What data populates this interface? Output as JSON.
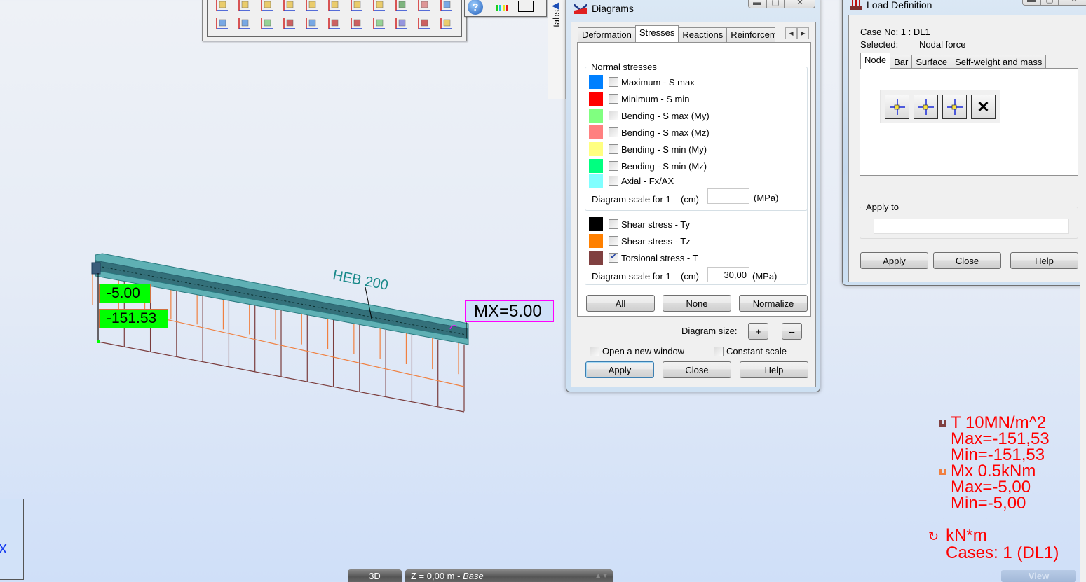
{
  "viewport": {
    "section_label": "HEB 200",
    "moment_label": "MX=5.00",
    "value_labels": [
      "-5.00",
      "-151.53"
    ],
    "corner_axis": "x",
    "colors": {
      "beam": "#4fa3a8",
      "torsion_diagram": "#7a3c3c",
      "moment_diagram": "#f08040",
      "value_label_bg": "#00ff00",
      "moment_label_border": "#ff00ff"
    }
  },
  "toolbar": {
    "row1_icons": [
      "view-xz-icon",
      "view-yz-icon",
      "view-xy-icon",
      "view-3d-icon",
      "axis-xz-icon",
      "axis-yz-icon",
      "axis-xy-icon",
      "structure-view-icon",
      "section-view-icon",
      "rotate-3d-icon",
      "rotate-x-icon"
    ],
    "row2_icons": [
      "rotate-y-icon",
      "rotate-z-icon",
      "zoom-window-icon",
      "zoom-previous-icon",
      "zoom-all-icon",
      "rotate-icon",
      "rotate-around-icon",
      "zoom-in-out-icon",
      "pan-icon",
      "render-icon",
      "windows-icon"
    ],
    "toolbar2_icons": [
      "help-icon",
      "legend-colors-icon",
      "table-icon"
    ]
  },
  "tabs_strip": {
    "label": "tabs"
  },
  "diagrams": {
    "title": "Diagrams",
    "tabs": [
      "Deformation",
      "Stresses",
      "Reactions",
      "Reinforcem"
    ],
    "active_tab": "Stresses",
    "normal_group_label": "Normal stresses",
    "normal_items": [
      {
        "label": "Maximum - S max",
        "color": "#0080ff",
        "checked": false
      },
      {
        "label": "Minimum - S min",
        "color": "#ff0000",
        "checked": false
      },
      {
        "label": "Bending - S max (My)",
        "color": "#80ff80",
        "checked": false
      },
      {
        "label": "Bending - S max (Mz)",
        "color": "#ff8080",
        "checked": false
      },
      {
        "label": "Bending - S min (My)",
        "color": "#ffff80",
        "checked": false
      },
      {
        "label": "Bending - S min (Mz)",
        "color": "#00ff80",
        "checked": false
      },
      {
        "label": "Axial - Fx/AX",
        "color": "#80ffff",
        "checked": false
      }
    ],
    "scale_label": "Diagram scale for 1",
    "scale_unit_cm": "(cm)",
    "scale_unit_mpa": "(MPa)",
    "normal_scale_value": "",
    "shear_items": [
      {
        "label": "Shear stress - Ty",
        "color": "#000000",
        "checked": false
      },
      {
        "label": "Shear stress - Tz",
        "color": "#ff8000",
        "checked": false
      },
      {
        "label": "Torsional stress - T",
        "color": "#804040",
        "checked": true
      }
    ],
    "shear_scale_value": "30,00",
    "btn_all": "All",
    "btn_none": "None",
    "btn_normalize": "Normalize",
    "diagram_size_label": "Diagram size:",
    "size_plus": "+",
    "size_minus": "--",
    "open_new_window": {
      "label": "Open a new window",
      "checked": false
    },
    "constant_scale": {
      "label": "Constant scale",
      "checked": false
    },
    "btn_apply": "Apply",
    "btn_close": "Close",
    "btn_help": "Help"
  },
  "load_definition": {
    "title": "Load Definition",
    "case_line": "Case No: 1 : DL1",
    "selected_label": "Selected:",
    "selected_value": "Nodal force",
    "tabs": [
      "Node",
      "Bar",
      "Surface",
      "Self-weight and mass"
    ],
    "active_tab": "Node",
    "tool_icons": [
      "nodal-force-icon",
      "imposed-displacement-icon",
      "nodal-force-grid-icon",
      "delete-load-icon"
    ],
    "apply_to_label": "Apply to",
    "apply_to_value": "",
    "btn_apply": "Apply",
    "btn_close": "Close",
    "btn_help": "Help"
  },
  "legend": {
    "t_line": "T    10MN/m^2",
    "t_max": "Max=-151,53",
    "t_min": "Min=-151,53",
    "mx_line": "Mx  0.5kNm",
    "mx_max": "Max=-5,00",
    "mx_min": "Min=-5,00",
    "unit": "kN*m",
    "cases": "Cases: 1 (DL1)",
    "t_color": "#804040",
    "mx_color": "#f08040"
  },
  "bottom_bar": {
    "view_mode": "3D",
    "level_text": "Z = 0,00 m - ",
    "level_name": "Base",
    "view_button": "View"
  }
}
